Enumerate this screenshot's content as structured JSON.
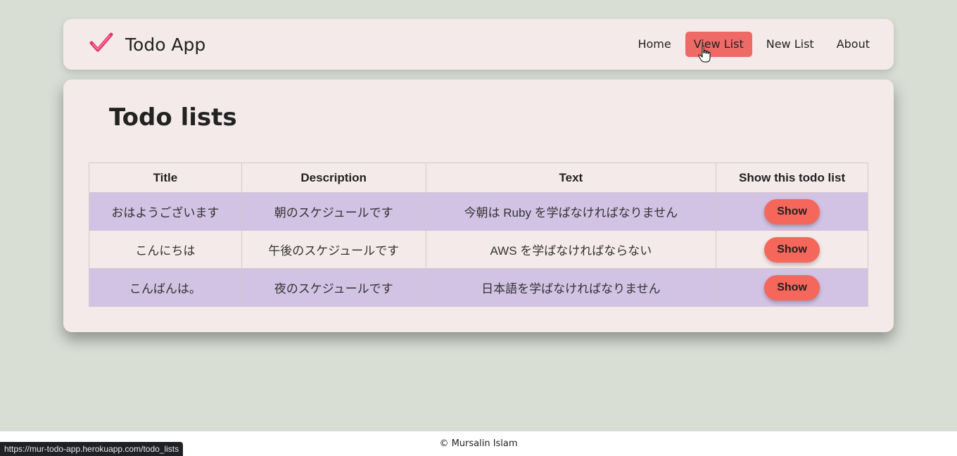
{
  "brand": {
    "name": "Todo App",
    "icon": "checkmark-icon",
    "icon_color": "#e8336e"
  },
  "nav": {
    "items": [
      {
        "label": "Home",
        "active": false
      },
      {
        "label": "View List",
        "active": true
      },
      {
        "label": "New List",
        "active": false
      },
      {
        "label": "About",
        "active": false
      }
    ]
  },
  "main": {
    "title": "Todo lists",
    "table": {
      "headers": [
        "Title",
        "Description",
        "Text",
        "Show this todo list"
      ],
      "rows": [
        {
          "title": "おはようございます",
          "description": "朝のスケジュールです",
          "text": "今朝は Ruby を学ばなければなりません",
          "action": "Show"
        },
        {
          "title": "こんにちは",
          "description": "午後のスケジュールです",
          "text": "AWS を学ばなければならない",
          "action": "Show"
        },
        {
          "title": "こんばんは。",
          "description": "夜のスケジュールです",
          "text": "日本語を学ばなければなりません",
          "action": "Show"
        }
      ]
    }
  },
  "footer": {
    "text": "© Mursalin Islam"
  },
  "status_bar": {
    "url": "https://mur-todo-app.herokuapp.com/todo_lists"
  },
  "colors": {
    "background": "#d8ded4",
    "card": "#f4eaea",
    "active_nav": "#ee6a66",
    "row_highlight": "#d2c2e4",
    "button": "#f5675a"
  }
}
